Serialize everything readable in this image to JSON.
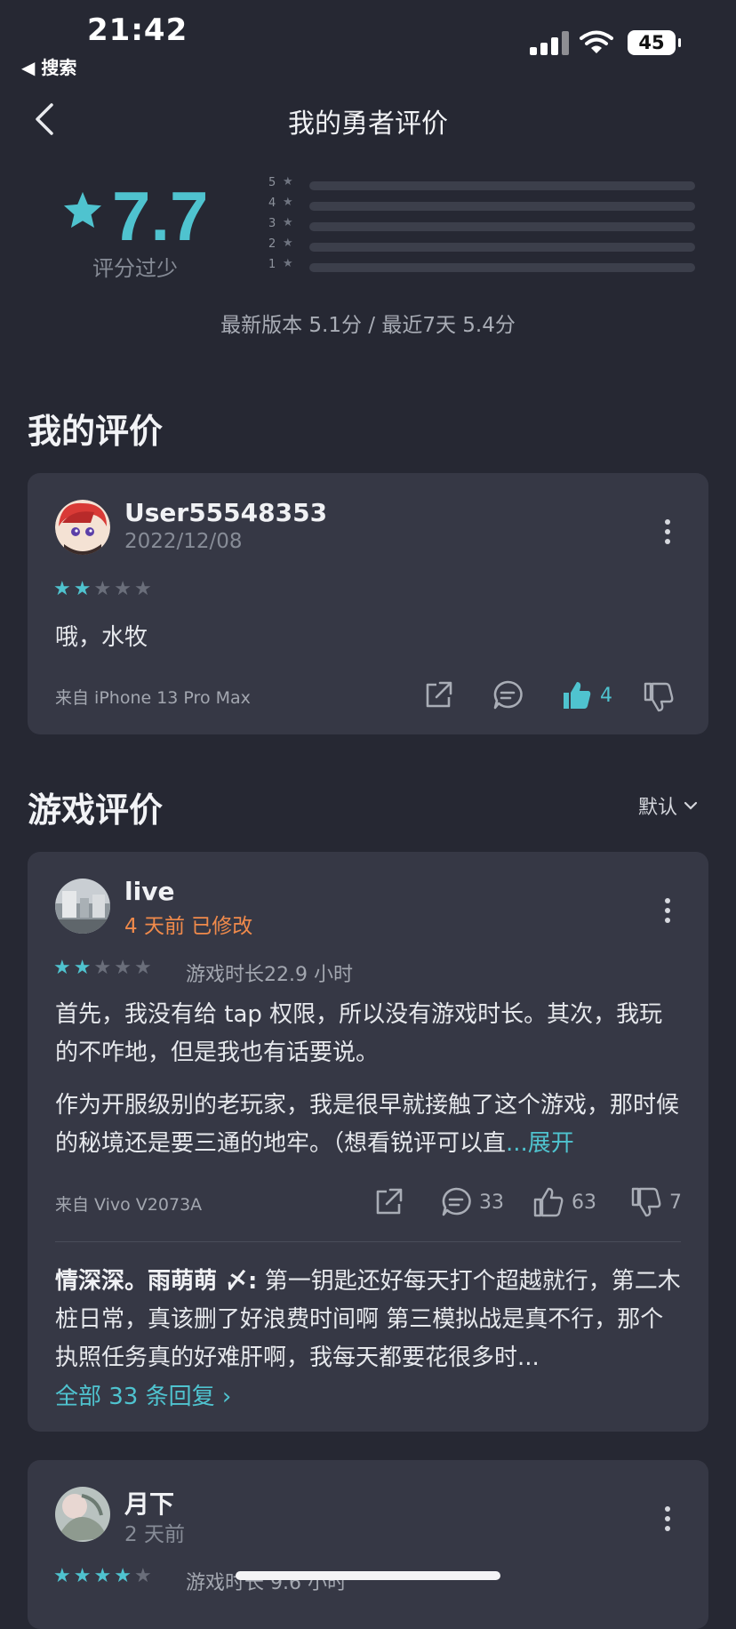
{
  "status_bar": {
    "time": "21:42",
    "back_label": "◀ 搜索",
    "battery": "45"
  },
  "nav": {
    "title": "我的勇者评价"
  },
  "summary": {
    "rating": "7.7",
    "note": "评分过少",
    "bars": [
      "5",
      "4",
      "3",
      "2",
      "1"
    ],
    "version_score": "最新版本 5.1分 / 最近7天 5.4分"
  },
  "my_review_section": {
    "title": "我的评价",
    "review": {
      "user": "User55548353",
      "date": "2022/12/08",
      "stars": 2,
      "text": "哦，水牧",
      "device": "来自 iPhone 13 Pro Max",
      "likes": "4"
    }
  },
  "game_reviews_section": {
    "title": "游戏评价",
    "sort_label": "默认",
    "reviews": [
      {
        "user": "live",
        "time": "4 天前 已修改",
        "stars": 2,
        "playtime": "游戏时长22.9 小时",
        "para1": "首先，我没有给 tap 权限，所以没有游戏时长。其次，我玩的不咋地，但是我也有话要说。",
        "para2": "作为开服级别的老玩家，我是很早就接触了这个游戏，那时候的秘境还是要三通的地牢。（想看锐评可以直",
        "expand": "...展开",
        "device": "来自 Vivo V2073A",
        "comments": "33",
        "likes": "63",
        "dislikes": "7",
        "reply_author": "情深深。雨萌萌 〆:",
        "reply_text": " 第一钥匙还好每天打个超越就行，第二木桩日常，真该删了好浪费时间啊 第三模拟战是真不行，那个执照任务真的好难肝啊，我每天都要花很多时...",
        "all_replies": "全部 33 条回复 ›"
      },
      {
        "user": "月下",
        "time": "2 天前",
        "stars": 4,
        "playtime": "游戏时长 9.6 小时"
      }
    ]
  },
  "colors": {
    "accent": "#4fc3cf",
    "orange": "#f08a4b",
    "bg": "#262833",
    "card": "#363845"
  }
}
